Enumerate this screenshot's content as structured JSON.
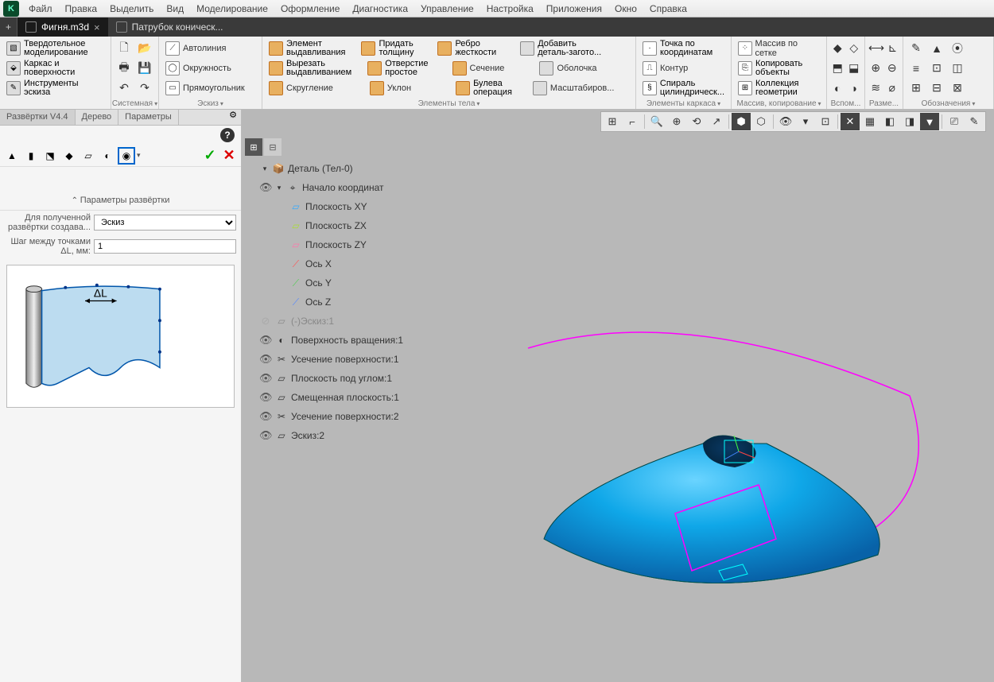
{
  "menu": {
    "items": [
      "Файл",
      "Правка",
      "Выделить",
      "Вид",
      "Моделирование",
      "Оформление",
      "Диагностика",
      "Управление",
      "Настройка",
      "Приложения",
      "Окно",
      "Справка"
    ]
  },
  "tabs": [
    {
      "label": "Фигня.m3d",
      "active": true,
      "closable": true
    },
    {
      "label": "Патрубок коническ...",
      "active": false,
      "closable": false
    }
  ],
  "ribbon": {
    "g0": {
      "solid1": "Твердотельное",
      "solid2": "моделирование",
      "frame1": "Каркас и",
      "frame2": "поверхности",
      "sketch1": "Инструменты",
      "sketch2": "эскиза"
    },
    "sys": {
      "name": "Системная"
    },
    "sketch": {
      "name": "Эскиз",
      "autoline": "Автолиния",
      "circle": "Окружность",
      "rect": "Прямоугольник"
    },
    "body": {
      "name": "Элементы тела",
      "extr1": "Элемент",
      "extr2": "выдавливания",
      "cut1": "Вырезать",
      "cut2": "выдавливанием",
      "fillet": "Скругление",
      "thick1": "Придать",
      "thick2": "толщину",
      "hole1": "Отверстие",
      "hole2": "простое",
      "draft": "Уклон",
      "rib1": "Ребро",
      "rib2": "жесткости",
      "sect": "Сечение",
      "bool1": "Булева",
      "bool2": "операция",
      "add1": "Добавить",
      "add2": "деталь-загото...",
      "shell": "Оболочка",
      "scale": "Масштабиров..."
    },
    "frame": {
      "name": "Элементы каркаса",
      "pt1": "Точка по",
      "pt2": "координатам",
      "contour": "Контур",
      "spiral1": "Спираль",
      "spiral2": "цилиндрическ..."
    },
    "arr": {
      "name": "Массив, копирование",
      "grid": "Массив по сетке",
      "copy1": "Копировать",
      "copy2": "объекты",
      "coll1": "Коллекция",
      "coll2": "геометрии"
    },
    "aux": {
      "name": "Вспом..."
    },
    "dim": {
      "name": "Разме..."
    },
    "ann": {
      "name": "Обозначения"
    }
  },
  "leftpanel": {
    "tabs": [
      "Развёртки V4.4",
      "Дерево",
      "Параметры"
    ],
    "section": "Параметры развёртки",
    "row1lbl": "Для полученной развёртки создава...",
    "row1val": "Эскиз",
    "row2lbl": "Шаг между точками ΔL, мм:",
    "row2val": "1",
    "delta": "ΔL"
  },
  "tree": {
    "root": "Деталь (Тел-0)",
    "origin": "Начало координат",
    "planes": [
      "Плоскость XY",
      "Плоскость ZX",
      "Плоскость ZY"
    ],
    "axes": [
      "Ось X",
      "Ось Y",
      "Ось Z"
    ],
    "items": [
      {
        "label": "(-)Эскиз:1",
        "gray": true
      },
      {
        "label": "Поверхность вращения:1"
      },
      {
        "label": "Усечение поверхности:1"
      },
      {
        "label": "Плоскость под углом:1"
      },
      {
        "label": "Смещенная плоскость:1"
      },
      {
        "label": "Усечение поверхности:2"
      },
      {
        "label": "Эскиз:2"
      }
    ]
  }
}
